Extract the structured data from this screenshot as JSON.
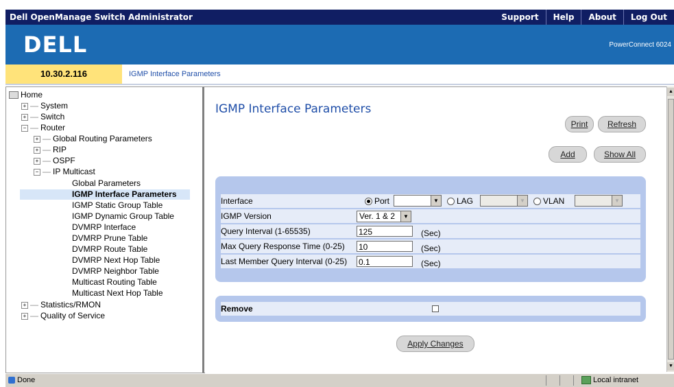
{
  "header": {
    "app_title": "Dell OpenManage Switch Administrator",
    "nav": [
      "Support",
      "Help",
      "About",
      "Log Out"
    ],
    "logo": "DELL",
    "model": "PowerConnect 6024"
  },
  "address": {
    "ip": "10.30.2.116",
    "breadcrumb": "IGMP Interface Parameters"
  },
  "tree": {
    "home": "Home",
    "system": "System",
    "switch": "Switch",
    "router": "Router",
    "global_routing": "Global Routing Parameters",
    "rip": "RIP",
    "ospf": "OSPF",
    "ip_multicast": "IP Multicast",
    "global_parameters": "Global Parameters",
    "igmp_interface": "IGMP Interface Parameters",
    "igmp_static": "IGMP Static Group Table",
    "igmp_dynamic": "IGMP Dynamic Group Table",
    "dvmrp_interface": "DVMRP Interface",
    "dvmrp_prune": "DVMRP Prune Table",
    "dvmrp_route": "DVMRP Route Table",
    "dvmrp_nexthop": "DVMRP Next Hop Table",
    "dvmrp_neighbor": "DVMRP Neighbor Table",
    "mcast_routing": "Multicast Routing Table",
    "mcast_nexthop": "Multicast Next Hop Table",
    "stats": "Statistics/RMON",
    "qos": "Quality of Service"
  },
  "main": {
    "title": "IGMP Interface Parameters",
    "buttons": {
      "print": "Print",
      "refresh": "Refresh",
      "add": "Add",
      "show_all": "Show All",
      "apply": "Apply Changes"
    },
    "form": {
      "interface_label": "Interface",
      "port_label": "Port",
      "lag_label": "LAG",
      "vlan_label": "VLAN",
      "selected_interface": "Port",
      "igmp_version_label": "IGMP Version",
      "igmp_version_value": "Ver. 1 & 2",
      "query_interval_label": "Query Interval (1-65535)",
      "query_interval_value": "125",
      "max_query_label": "Max Query Response Time (0-25)",
      "max_query_value": "10",
      "last_member_label": "Last Member Query Interval (0-25)",
      "last_member_value": "0.1",
      "unit": "(Sec)"
    },
    "remove": {
      "label": "Remove",
      "checked": false
    }
  },
  "status": {
    "text": "Done",
    "zone": "Local intranet"
  }
}
